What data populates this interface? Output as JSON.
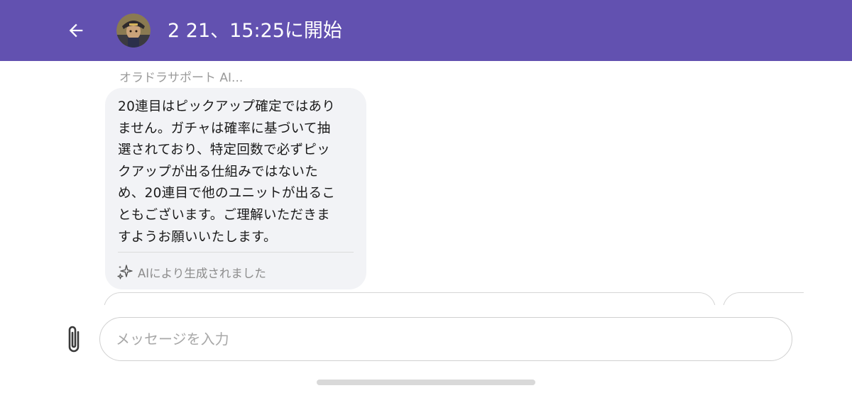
{
  "colors": {
    "header_bg": "#6251b0",
    "bubble_bg": "#f2f3f6",
    "text": "#1a1a1a",
    "muted": "#9a9a9a",
    "sparkle": "#555555"
  },
  "header": {
    "back_icon": "arrow-left-icon",
    "avatar": "user-avatar",
    "title": "2 21、15:25に開始"
  },
  "message": {
    "sender": "オラドラサポート AI...",
    "lines": [
      "20連目はピックアップ確定ではあり",
      "ません。ガチャは確率に基づいて抽",
      "選されており、特定回数で必ずピッ",
      "クアップが出る仕組みではないた",
      "め、20連目で他のユニットが出るこ",
      "ともございます。ご理解いただきま",
      "すようお願いいたします。"
    ],
    "ai_icon": "sparkle-icon",
    "ai_label": "AIにより生成されました"
  },
  "composer": {
    "attach_icon": "paperclip-icon",
    "placeholder": "メッセージを入力"
  }
}
